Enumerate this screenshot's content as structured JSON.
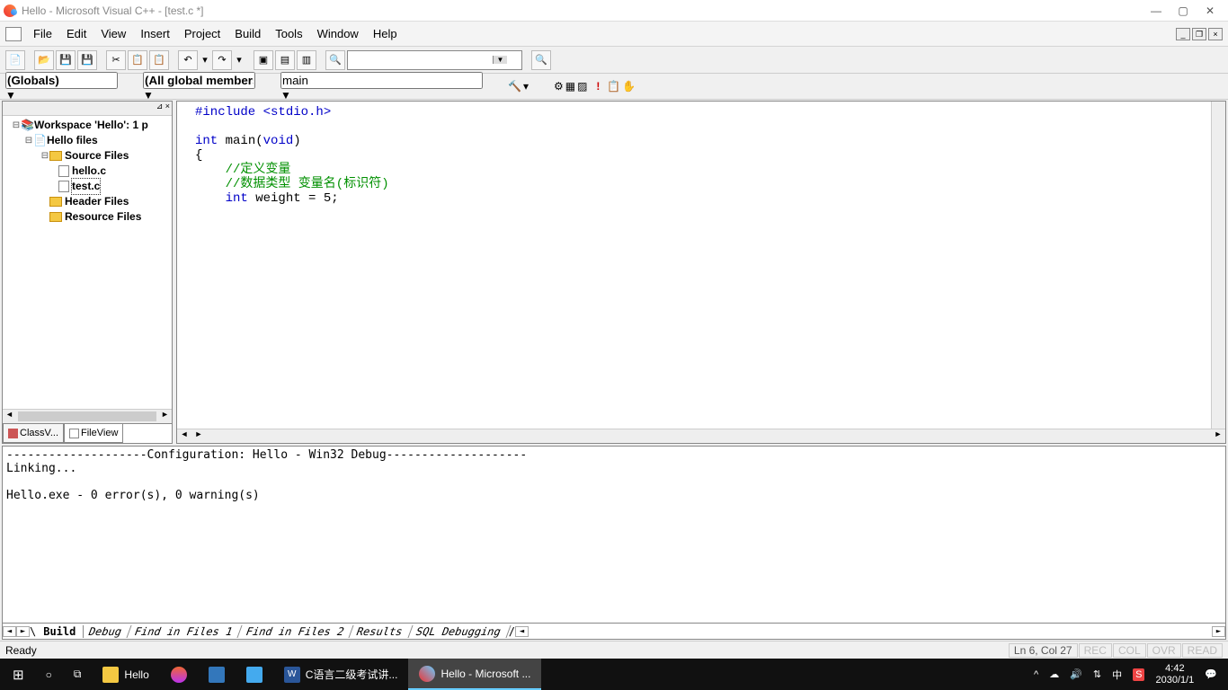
{
  "title": "Hello - Microsoft Visual C++ - [test.c *]",
  "menu": [
    "File",
    "Edit",
    "View",
    "Insert",
    "Project",
    "Build",
    "Tools",
    "Window",
    "Help"
  ],
  "combo1": "(Globals)",
  "combo2": "(All global members",
  "combo3": "main",
  "workspace": {
    "root": "Workspace 'Hello': 1 p",
    "project": "Hello files",
    "folders": {
      "source": "Source Files",
      "header": "Header Files",
      "resource": "Resource Files"
    },
    "files": {
      "hello": "hello.c",
      "test": "test.c"
    }
  },
  "ws_tabs": {
    "class": "ClassV...",
    "file": "FileView"
  },
  "code_lines": {
    "l1": "#include <stdio.h>",
    "l2": "",
    "l3a": "int",
    "l3b": " main(",
    "l3c": "void",
    "l3d": ")",
    "l4": "{",
    "l5": "    //定义变量",
    "l6": "    //数据类型 变量名(标识符)",
    "l7a": "    ",
    "l7b": "int",
    "l7c": " weight = 5;"
  },
  "output": {
    "line1": "--------------------Configuration: Hello - Win32 Debug--------------------",
    "line2": "Linking...",
    "line3": "",
    "line4": "Hello.exe - 0 error(s), 0 warning(s)"
  },
  "output_tabs": [
    "Build",
    "Debug",
    "Find in Files 1",
    "Find in Files 2",
    "Results",
    "SQL Debugging"
  ],
  "status": {
    "ready": "Ready",
    "pos": "Ln 6, Col 27",
    "rec": "REC",
    "col": "COL",
    "ovr": "OVR",
    "read": "READ"
  },
  "taskbar": {
    "folder": "Hello",
    "word": "C语言二级考试讲...",
    "vc": "Hello - Microsoft ...",
    "time": "4:42",
    "date": "2030/1/1",
    "ime": "中"
  }
}
